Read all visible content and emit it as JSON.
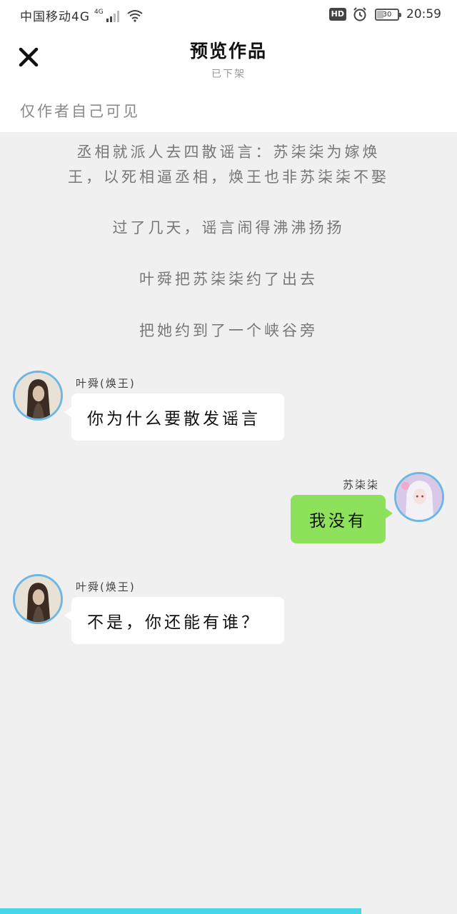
{
  "status_bar": {
    "carrier": "中国移动4G",
    "network_small": "4G",
    "hd": "HD",
    "battery": "30",
    "time": "20:59"
  },
  "header": {
    "title": "预览作品",
    "subtitle": "已下架",
    "visibility": "仅作者自己可见",
    "close_icon": "close-icon"
  },
  "story": {
    "narrations": [
      "丞相就派人去四散谣言：苏柒柒为嫁焕王，以死相逼丞相，焕王也非苏柒柒不娶",
      "过了几天，谣言闹得沸沸扬扬",
      "叶舜把苏柒柒约了出去",
      "把她约到了一个峡谷旁"
    ],
    "messages": [
      {
        "speaker": "叶舜(焕王)",
        "text": "你为什么要散发谣言",
        "side": "left"
      },
      {
        "speaker": "苏柒柒",
        "text": "我没有",
        "side": "right"
      },
      {
        "speaker": "叶舜(焕王)",
        "text": "不是，你还能有谁？",
        "side": "left"
      }
    ]
  },
  "narration_lines": {
    "n1a": "丞相就派人去四散谣言：苏柒柒为嫁焕",
    "n1b": "王，以死相逼丞相，焕王也非苏柒柒不娶"
  },
  "progress": {
    "fraction": 0.79
  },
  "colors": {
    "accent": "#45d6e8",
    "bubble_green": "#8ee25b",
    "avatar_border": "#6fb6e3",
    "background": "#f0f0f0"
  }
}
